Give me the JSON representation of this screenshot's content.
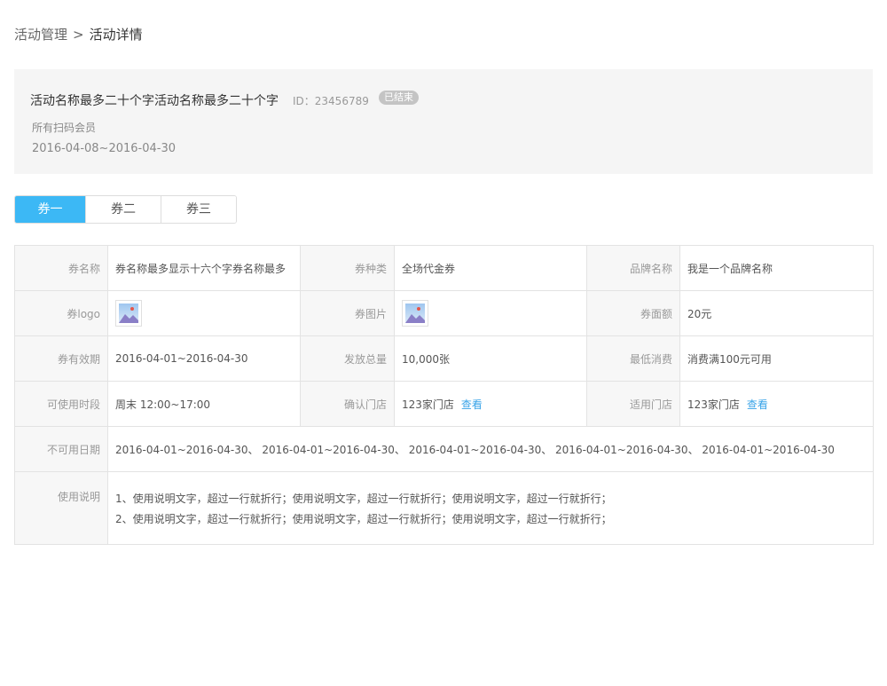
{
  "breadcrumb": {
    "parent": "活动管理",
    "separator": ">",
    "current": "活动详情"
  },
  "activity": {
    "name": "活动名称最多二十个字活动名称最多二十个字",
    "id_text": "ID：23456789",
    "status": "已结束",
    "audience": "所有扫码会员",
    "date_range": "2016-04-08~2016-04-30"
  },
  "tabs": [
    {
      "label": "券一",
      "active": true
    },
    {
      "label": "券二",
      "active": false
    },
    {
      "label": "券三",
      "active": false
    }
  ],
  "details": {
    "coupon_name_label": "券名称",
    "coupon_name_value": "券名称最多显示十六个字券名称最多",
    "coupon_type_label": "券种类",
    "coupon_type_value": "全场代金券",
    "brand_label": "品牌名称",
    "brand_value": "我是一个品牌名称",
    "logo_label": "券logo",
    "image_label": "券图片",
    "face_value_label": "券面额",
    "face_value_value": "20元",
    "validity_label": "券有效期",
    "validity_value": "2016-04-01~2016-04-30",
    "issued_label": "发放总量",
    "issued_value": "10,000张",
    "min_spend_label": "最低消费",
    "min_spend_value": "消费满100元可用",
    "time_label": "可使用时段",
    "time_value": "周末 12:00~17:00",
    "confirm_store_label": "确认门店",
    "confirm_store_value": "123家门店",
    "applicable_store_label": "适用门店",
    "applicable_store_value": "123家门店",
    "view_link": "查看",
    "unavailable_label": "不可用日期",
    "unavailable_value": "2016-04-01~2016-04-30、 2016-04-01~2016-04-30、 2016-04-01~2016-04-30、 2016-04-01~2016-04-30、 2016-04-01~2016-04-30",
    "usage_label": "使用说明",
    "usage_lines": [
      "1、使用说明文字，超过一行就折行；使用说明文字，超过一行就折行；使用说明文字，超过一行就折行；",
      "2、使用说明文字，超过一行就折行；使用说明文字，超过一行就折行；使用说明文字，超过一行就折行；"
    ]
  },
  "colors": {
    "accent": "#3cb8f5",
    "link": "#3aa4e8",
    "badge": "#c4c4c4",
    "panel": "#f5f5f5"
  },
  "icons": {
    "logo_thumb": "image-thumbnail-icon",
    "image_thumb": "image-thumbnail-icon"
  }
}
